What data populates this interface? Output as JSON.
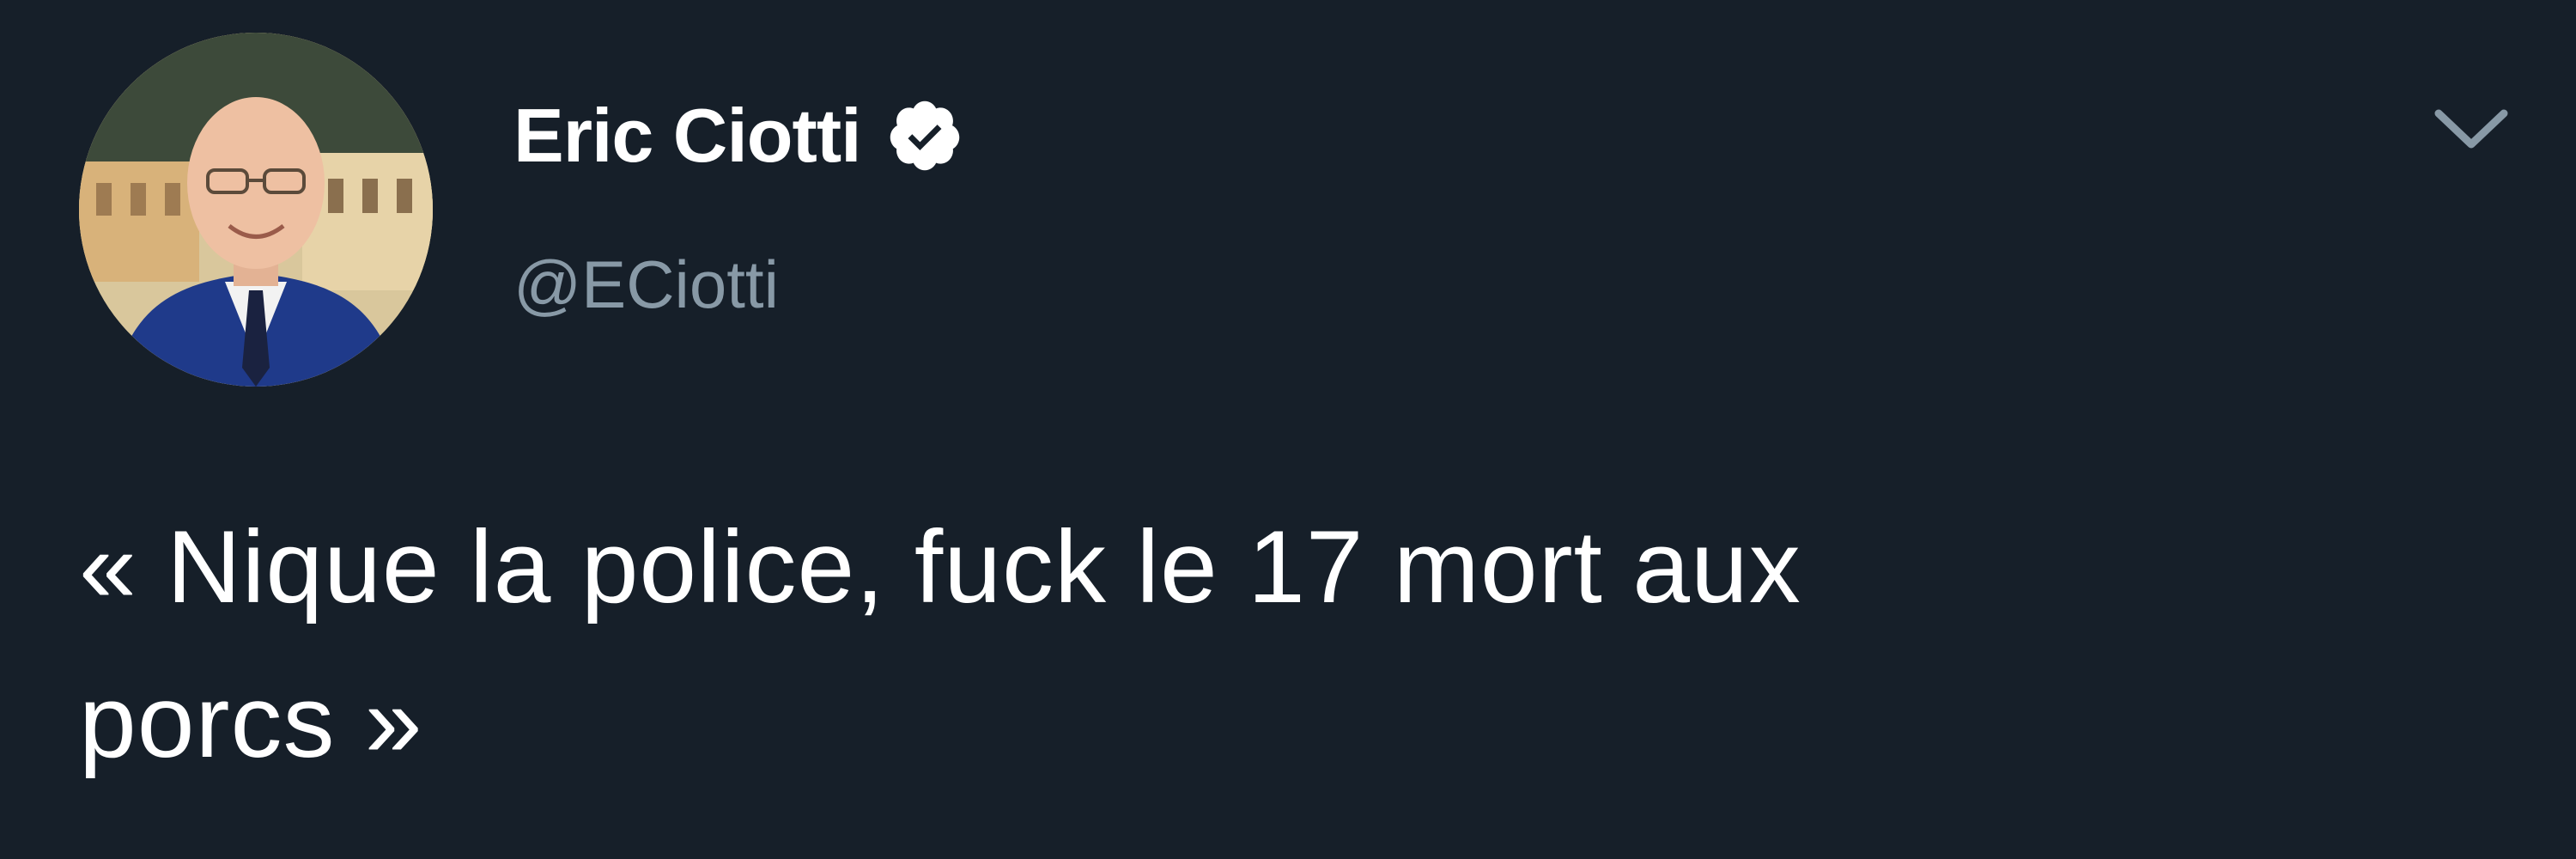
{
  "tweet": {
    "author": {
      "display_name": "Eric Ciotti",
      "handle": "@ECiotti",
      "verified": true,
      "avatar_icon": "profile-photo"
    },
    "menu_icon": "chevron-down-icon",
    "text_lines": [
      "« Nique la police, fuck le 17 mort aux",
      "porcs »"
    ]
  },
  "colors": {
    "background": "#161f29",
    "text": "#ffffff",
    "secondary_text": "#8899a6"
  }
}
